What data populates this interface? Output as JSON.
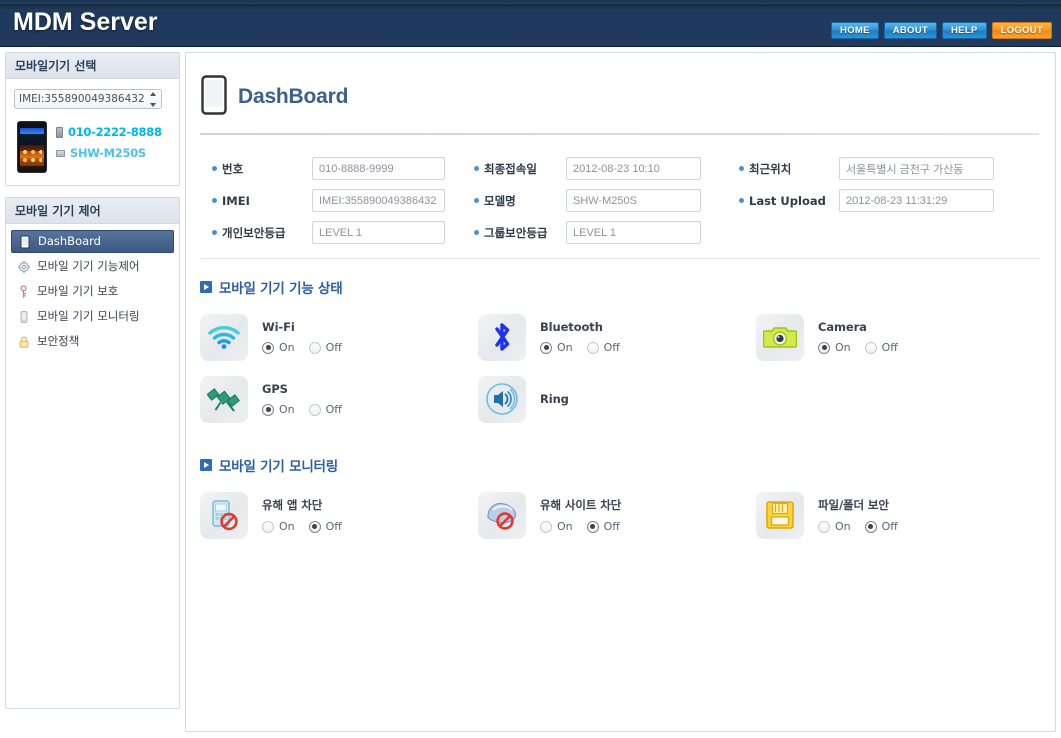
{
  "header": {
    "brand": "MDM Server",
    "nav": [
      {
        "label": "HOME",
        "kind": "primary"
      },
      {
        "label": "ABOUT",
        "kind": "primary"
      },
      {
        "label": "HELP",
        "kind": "primary"
      },
      {
        "label": "LOGOUT",
        "kind": "logout"
      }
    ]
  },
  "sidebar": {
    "select_panel_title": "모바일기기 선택",
    "device_select_value": "IMEI:355890049386432",
    "device": {
      "phone_number": "010-2222-8888",
      "model": "SHW-M250S"
    },
    "menu_panel_title": "모바일 기기 제어",
    "menu": [
      {
        "label": "DashBoard",
        "icon": "device-icon",
        "active": true
      },
      {
        "label": "모바일 기기 기능제어",
        "icon": "gear-icon",
        "active": false
      },
      {
        "label": "모바일 기기 보호",
        "icon": "key-icon",
        "active": false
      },
      {
        "label": "모바일 기기 모니터링",
        "icon": "monitor-icon",
        "active": false
      },
      {
        "label": "보안정책",
        "icon": "lock-icon",
        "active": false
      }
    ]
  },
  "main": {
    "page_title": "DashBoard",
    "info": {
      "rows": [
        [
          {
            "label": "번호",
            "value": "010-8888-9999"
          },
          {
            "label": "최종접속일",
            "value": "2012-08-23 10:10"
          },
          {
            "label": "최근위치",
            "value": "서울특별시 금천구 가산동"
          }
        ],
        [
          {
            "label": "IMEI",
            "value": "IMEI:355890049386432"
          },
          {
            "label": "모델명",
            "value": "SHW-M250S"
          },
          {
            "label": "Last Upload",
            "value": "2012-08-23 11:31:29"
          }
        ],
        [
          {
            "label": "개인보안등급",
            "value": "LEVEL 1"
          },
          {
            "label": "그룹보안등급",
            "value": "LEVEL 1"
          },
          {
            "label": "",
            "value": ""
          }
        ]
      ]
    },
    "section_features": {
      "title": "모바일 기기 기능 상태",
      "on_label": "On",
      "off_label": "Off",
      "items": [
        {
          "name": "Wi-Fi",
          "icon": "wifi-icon",
          "state": "on",
          "has_radios": true
        },
        {
          "name": "Bluetooth",
          "icon": "bluetooth-icon",
          "state": "on",
          "has_radios": true
        },
        {
          "name": "Camera",
          "icon": "camera-icon",
          "state": "on",
          "has_radios": true
        },
        {
          "name": "GPS",
          "icon": "gps-satellite-icon",
          "state": "on",
          "has_radios": true
        },
        {
          "name": "Ring",
          "icon": "speaker-icon",
          "state": "none",
          "has_radios": false
        }
      ]
    },
    "section_monitoring": {
      "title": "모바일 기기 모니터링",
      "on_label": "On",
      "off_label": "Off",
      "items": [
        {
          "name": "유해 앱 차단",
          "icon": "app-block-icon",
          "state": "off",
          "has_radios": true
        },
        {
          "name": "유해 사이트 차단",
          "icon": "site-block-icon",
          "state": "off",
          "has_radios": true
        },
        {
          "name": "파일/폴더 보안",
          "icon": "floppy-lock-icon",
          "state": "off",
          "has_radios": true
        }
      ]
    }
  },
  "colors": {
    "header_bg": "#21395c",
    "nav_blue": "#2f8fd4",
    "nav_orange": "#f79420",
    "title_blue": "#3d5f8e",
    "section_blue": "#2e5fa0",
    "device_number": "#00b7e6",
    "device_model": "#4cc3e8",
    "menu_active": "#3c5a82"
  }
}
